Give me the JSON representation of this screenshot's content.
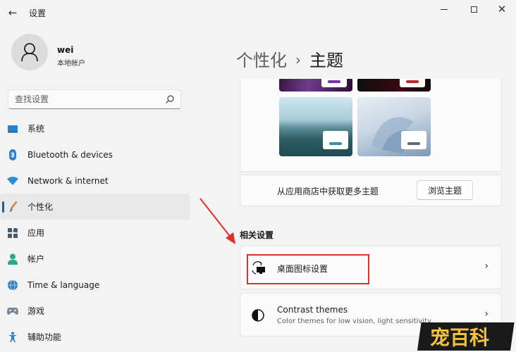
{
  "window": {
    "title": "设置",
    "back_glyph": "←",
    "close_glyph": "✕"
  },
  "user": {
    "name": "wei",
    "account_type": "本地帐户"
  },
  "search": {
    "placeholder": "查找设置"
  },
  "sidebar": {
    "items": [
      {
        "label": "系统",
        "icon": "system-icon"
      },
      {
        "label": "Bluetooth & devices",
        "icon": "bluetooth-icon"
      },
      {
        "label": "Network & internet",
        "icon": "wifi-icon"
      },
      {
        "label": "个性化",
        "icon": "brush-icon",
        "active": true
      },
      {
        "label": "应用",
        "icon": "apps-icon"
      },
      {
        "label": "帐户",
        "icon": "account-icon"
      },
      {
        "label": "Time & language",
        "icon": "globe-clock-icon"
      },
      {
        "label": "游戏",
        "icon": "gamepad-icon"
      },
      {
        "label": "辅助功能",
        "icon": "accessibility-icon"
      }
    ]
  },
  "breadcrumb": {
    "parent": "个性化",
    "separator": "›",
    "current": "主题"
  },
  "themes": {
    "store_text": "从应用商店中获取更多主题",
    "browse_button": "浏览主题",
    "accent_colors": [
      "#7b2fa8",
      "#c4262e",
      "#3f8ea4",
      "#5f6b78"
    ]
  },
  "related": {
    "section_title": "相关设置",
    "desktop_icons": {
      "title": "桌面图标设置",
      "icon": "desktop-icon-settings-icon"
    },
    "contrast": {
      "title": "Contrast themes",
      "subtitle": "Color themes for low vision, light sensitivity",
      "icon": "contrast-icon"
    },
    "chevron": "›"
  },
  "annotation": {
    "highlight_color": "#e0302c"
  },
  "watermark": {
    "text": "宠百科"
  }
}
